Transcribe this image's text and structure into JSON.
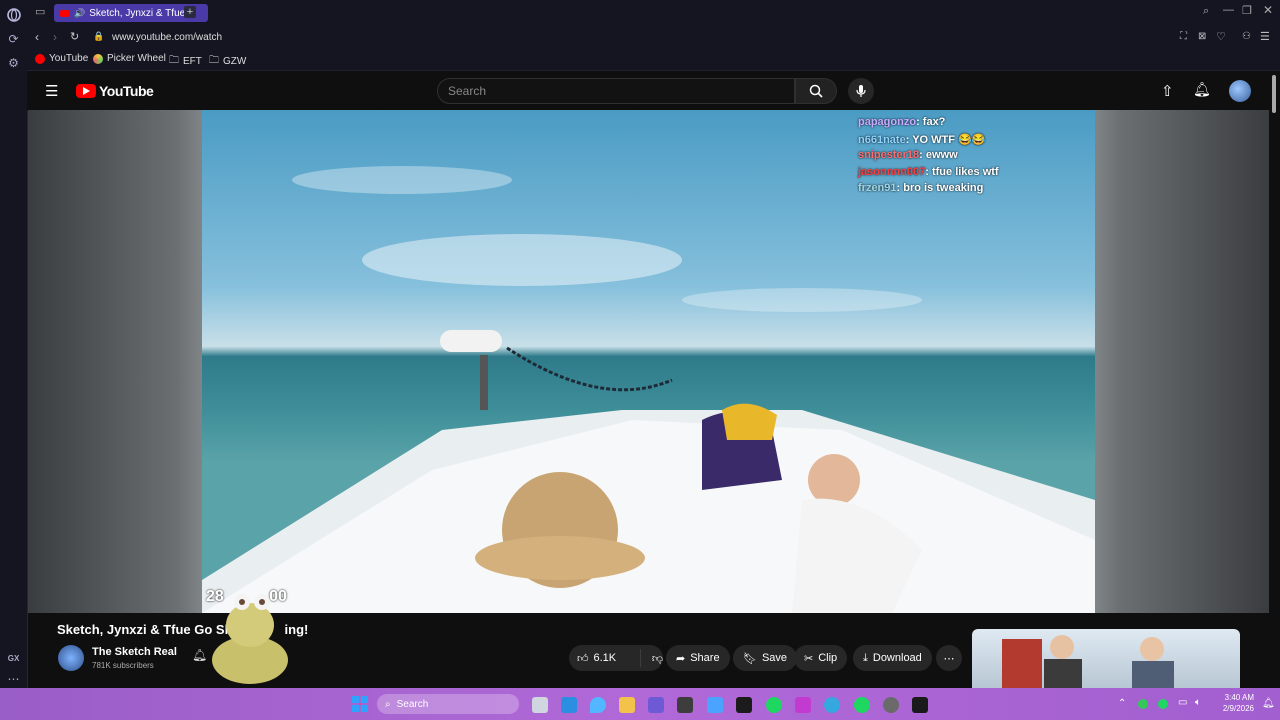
{
  "browser": {
    "tab_title": "Sketch, Jynxzi & Tfue G",
    "url": "www.youtube.com/watch",
    "bookmarks": [
      "YouTube",
      "Picker Wheel",
      "EFT",
      "GZW"
    ],
    "rail_label": "GX"
  },
  "youtube": {
    "logo_text": "YouTube",
    "search_placeholder": "Search"
  },
  "video": {
    "chat": [
      {
        "user": "papagonzo",
        "message": ": fax?",
        "color": "#c9a9ff"
      },
      {
        "user": "n661nate",
        "message": ": YO WTF 😂😂",
        "color": "#8fd3ff"
      },
      {
        "user": "snipester18",
        "message": ": ewww",
        "color": "#ff6a6a"
      },
      {
        "user": "jasonnnn007",
        "message": ": tfue likes wtf",
        "color": "#ff3b3b"
      },
      {
        "user": "frzen91",
        "message": ": bro is tweaking",
        "color": "#9fd6e6"
      }
    ],
    "overlay_counter_left": "28",
    "overlay_counter_right": "00"
  },
  "meta": {
    "title": "Sketch, Jynxzi & Tfue Go Sh",
    "title_tail": "ing!",
    "channel": "The Sketch Real",
    "subscribers": "781K subscribers",
    "likes": "6.1K",
    "actions": {
      "share": "Share",
      "save": "Save",
      "clip": "Clip",
      "download": "Download"
    }
  },
  "taskbar": {
    "search_label": "Search",
    "time": "3:40 AM",
    "date": "2/9/2026"
  },
  "colors": {
    "youtube_red": "#ff0000",
    "tab_accent": "#4a3aa8",
    "taskbar": "#b169d8"
  }
}
